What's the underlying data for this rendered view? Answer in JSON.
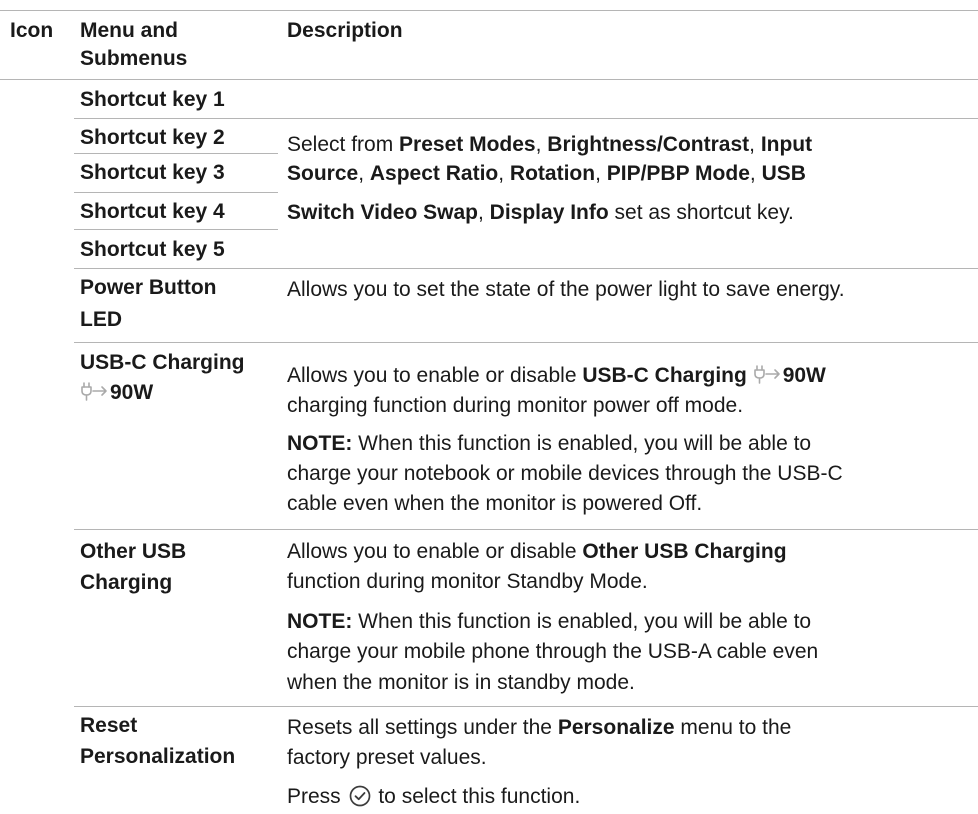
{
  "header": {
    "icon": "Icon",
    "menu": "Menu and Submenus",
    "desc": "Description"
  },
  "shortcut_keys": [
    "Shortcut key 1",
    "Shortcut key 2",
    "Shortcut key 3",
    "Shortcut key 4",
    "Shortcut key 5"
  ],
  "shortcut_desc": {
    "p1": "Select from ",
    "preset": "Preset Modes",
    "s1": ", ",
    "bright": "Brightness/Contrast",
    "s2": ", ",
    "input1": "Input",
    "input2": "Source",
    "s3": ", ",
    "aspect": "Aspect Ratio",
    "s4": ", ",
    "rotation": "Rotation",
    "s5": ", ",
    "pip": "PIP/PBP Mode",
    "s6": ", ",
    "usb": "USB",
    "swap": "Switch Video Swap",
    "s7": ", ",
    "display_info": "Display Info",
    "end": " set as shortcut key."
  },
  "power_led": {
    "label1": "Power Button",
    "label2": "LED",
    "desc": "Allows you to set the state of the power light to save energy."
  },
  "usbc": {
    "label1": "USB-C Charging",
    "label2": "90W",
    "desc_a": "Allows you to enable or disable ",
    "desc_b": "USB-C Charging",
    "desc_c": "90W",
    "desc_d": "charging function during monitor power off mode.",
    "note_label": "NOTE:",
    "note_1": " When this function is enabled, you will be able to",
    "note_2": "charge your notebook or mobile devices through the USB-C",
    "note_3": "cable even when the monitor is powered Off."
  },
  "other_usb": {
    "label1": "Other USB",
    "label2": "Charging",
    "desc_a": "Allows you to enable or disable ",
    "desc_b": "Other USB Charging",
    "desc_c": "function during monitor Standby Mode.",
    "note_label": "NOTE:",
    "note_1": " When this function is enabled, you will be able to",
    "note_2": "charge your mobile phone through the USB-A cable even",
    "note_3": "when the monitor is in standby mode."
  },
  "reset": {
    "label1": "Reset",
    "label2": "Personalization",
    "desc_a": "Resets all settings under the ",
    "desc_b": "Personalize",
    "desc_c": " menu to the",
    "desc_d": "factory preset values.",
    "press_a": "Press ",
    "press_b": " to select this function."
  },
  "icons": {
    "plug": "usb-c-power-plug-icon",
    "check": "checkmark-circle-icon"
  }
}
